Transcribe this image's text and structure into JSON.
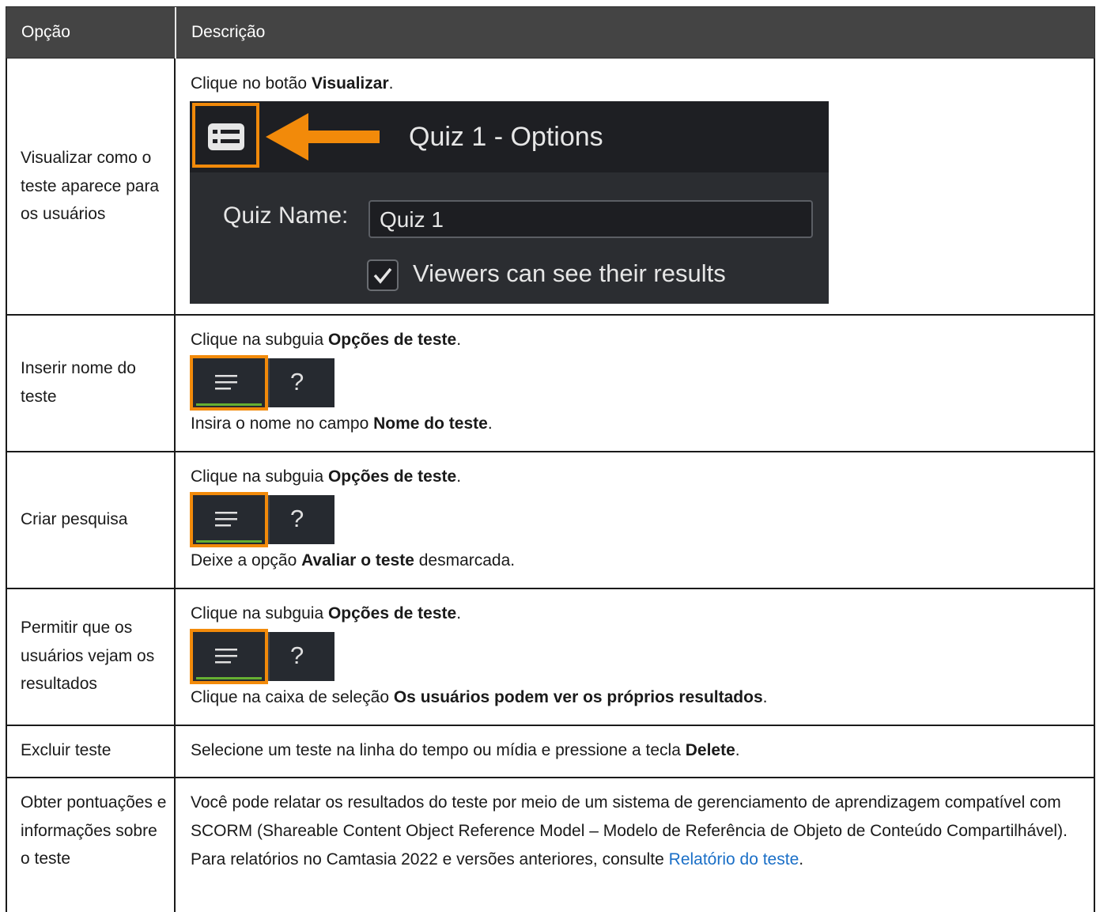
{
  "header": {
    "col1": "Opção",
    "col2": "Descrição"
  },
  "rows": [
    {
      "option": "Visualizar como o teste aparece para os usuários",
      "pre": "Clique no botão ",
      "bold": "Visualizar",
      "post": ".",
      "quiz": {
        "title": "Quiz 1 - Options",
        "name_label": "Quiz Name:",
        "name_value": "Quiz 1",
        "checkbox_label": "Viewers can see their results"
      }
    },
    {
      "option": "Inserir nome do teste",
      "pre": "Clique na subguia ",
      "bold": "Opções de teste",
      "post": ".",
      "pre2": "Insira o nome no campo ",
      "bold2": "Nome do teste",
      "post2": "."
    },
    {
      "option": "Criar pesquisa",
      "pre": "Clique na subguia ",
      "bold": "Opções de teste",
      "post": ".",
      "pre2": "Deixe a opção ",
      "bold2": "Avaliar o teste",
      "post2": " desmarcada."
    },
    {
      "option": "Permitir que os usuários vejam os resultados",
      "pre": "Clique na subguia ",
      "bold": "Opções de teste",
      "post": ".",
      "pre2": "Clique na caixa de seleção ",
      "bold2": "Os usuários podem ver os próprios resultados",
      "post2": "."
    },
    {
      "option": "Excluir teste",
      "pre": "Selecione um teste na linha do tempo ou mídia e pressione a tecla ",
      "bold": "Delete",
      "post": "."
    },
    {
      "option": "Obter pontuações e informações sobre o teste",
      "text": "Você pode relatar os resultados do teste por meio de um sistema de gerenciamento de aprendizagem compatível com SCORM (Shareable Content Object Reference Model – Modelo de Referência de Objeto de Conteúdo Compartilhável). Para relatórios no Camtasia 2022 e versões anteriores, consulte ",
      "link": "Relatório do teste",
      "post": "."
    }
  ],
  "subtab": {
    "help_glyph": "?"
  },
  "colors": {
    "header_bg": "#444444",
    "accent_orange": "#f28a0a",
    "link": "#1a6fc7",
    "active_green": "#66b032"
  }
}
